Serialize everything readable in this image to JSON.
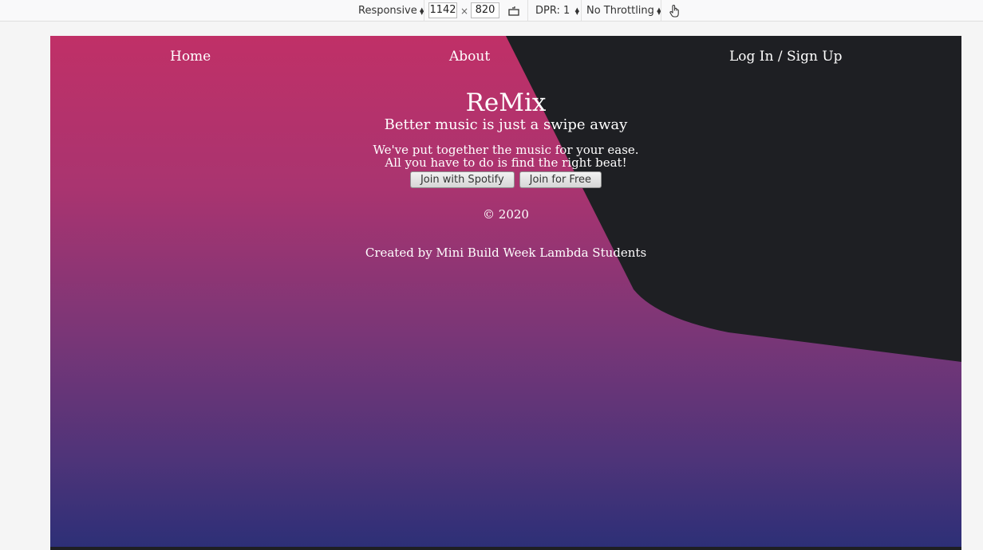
{
  "devtools": {
    "device_mode": "Responsive",
    "width": "1142",
    "times": "×",
    "height": "820",
    "dpr": "DPR: 1",
    "throttling": "No Throttling"
  },
  "nav": {
    "home": "Home",
    "about": "About",
    "login": "Log In / Sign Up"
  },
  "hero": {
    "title": "ReMix",
    "subtitle": "Better music is just a swipe away",
    "line1": "We've put together the music for your ease.",
    "line2": "All you have to do is find the right beat!",
    "spotify_button": "Join with Spotify",
    "free_button": "Join for Free"
  },
  "footer": {
    "copyright": "© 2020",
    "credit": "Created by Mini Build Week Lambda Students"
  },
  "colors": {
    "gradient_top": "#c03067",
    "gradient_bottom": "#2c2f77",
    "dark_panel": "#1e1f23"
  }
}
